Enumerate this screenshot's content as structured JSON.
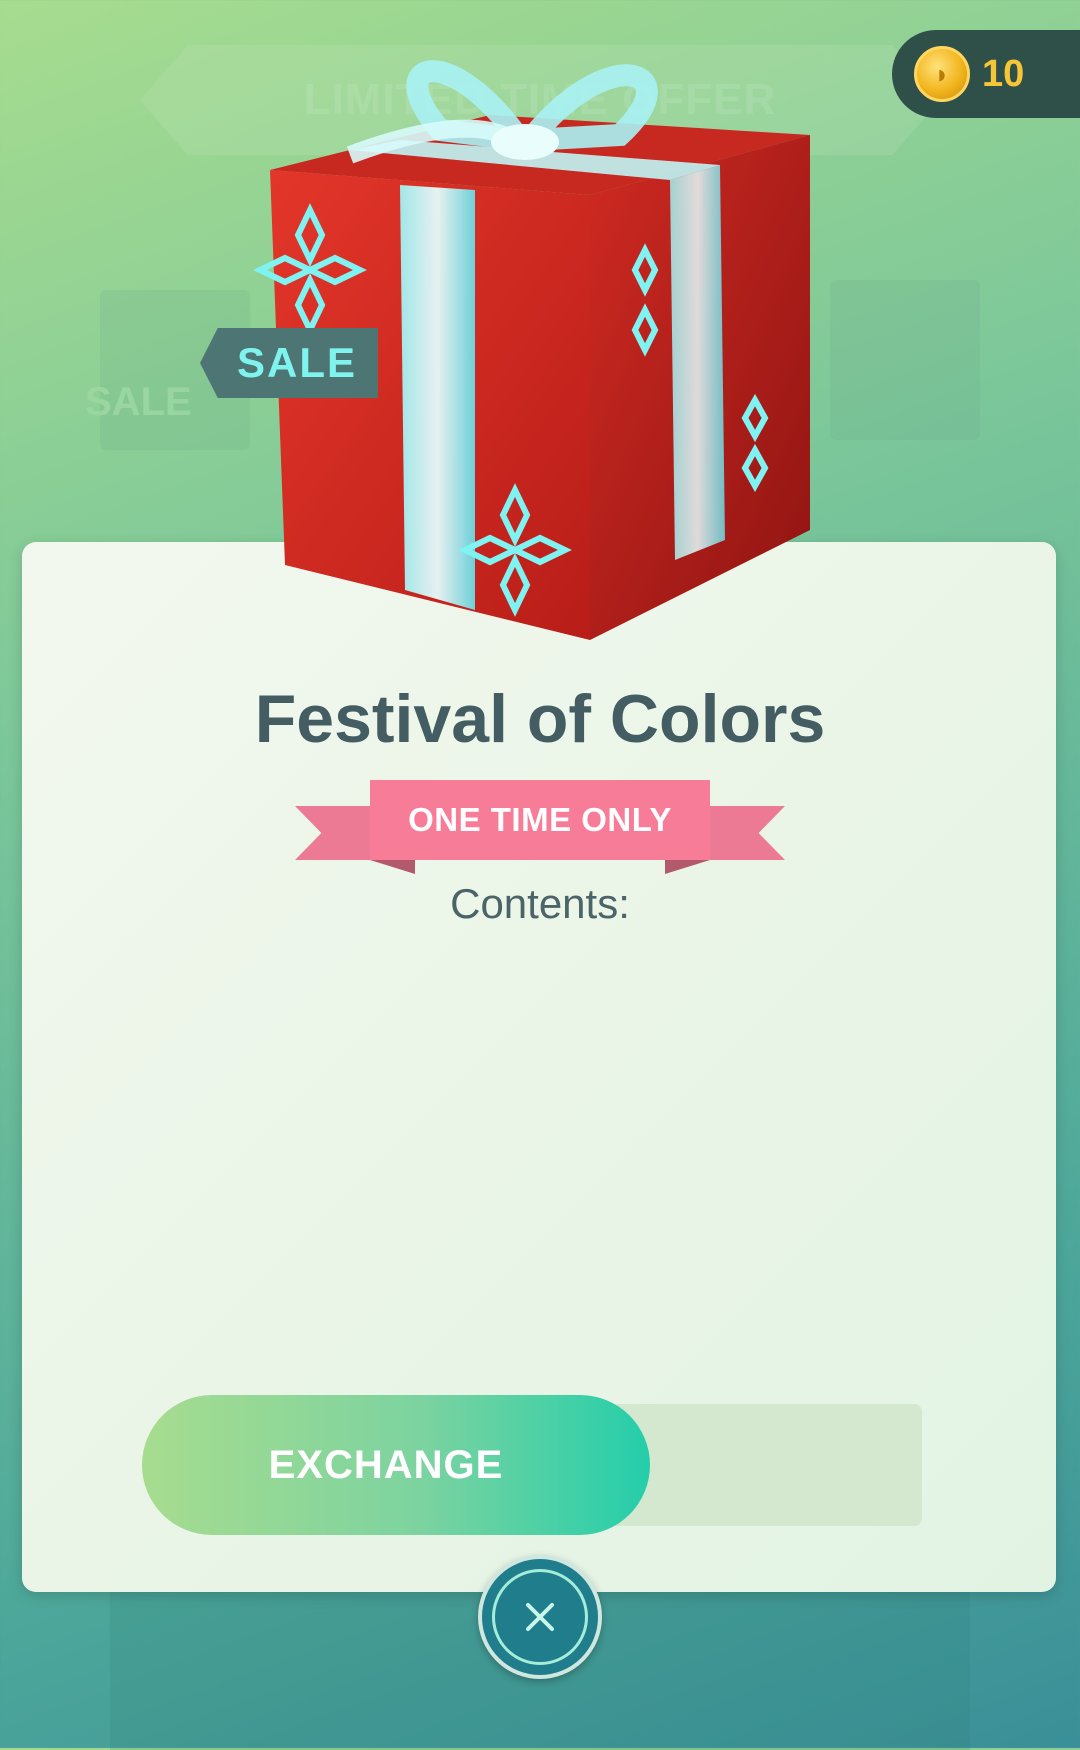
{
  "header": {
    "coin_icon": "pokecoin-icon",
    "coin_count": "10",
    "background_banner": "LIMITED TIME OFFER"
  },
  "offer": {
    "sale_tag": "SALE",
    "title": "Festival of Colors",
    "ribbon_label": "ONE TIME ONLY",
    "contents_label": "Contents:",
    "item_icon": "gift-box-icon"
  },
  "actions": {
    "exchange_label": "EXCHANGE",
    "close_icon": "close-icon"
  },
  "colors": {
    "accent_teal": "#24ceaa",
    "ribbon_pink": "#f77c98",
    "title_text": "#435d62",
    "gift_red": "#d8261d",
    "coin_gold": "#f6c638"
  }
}
